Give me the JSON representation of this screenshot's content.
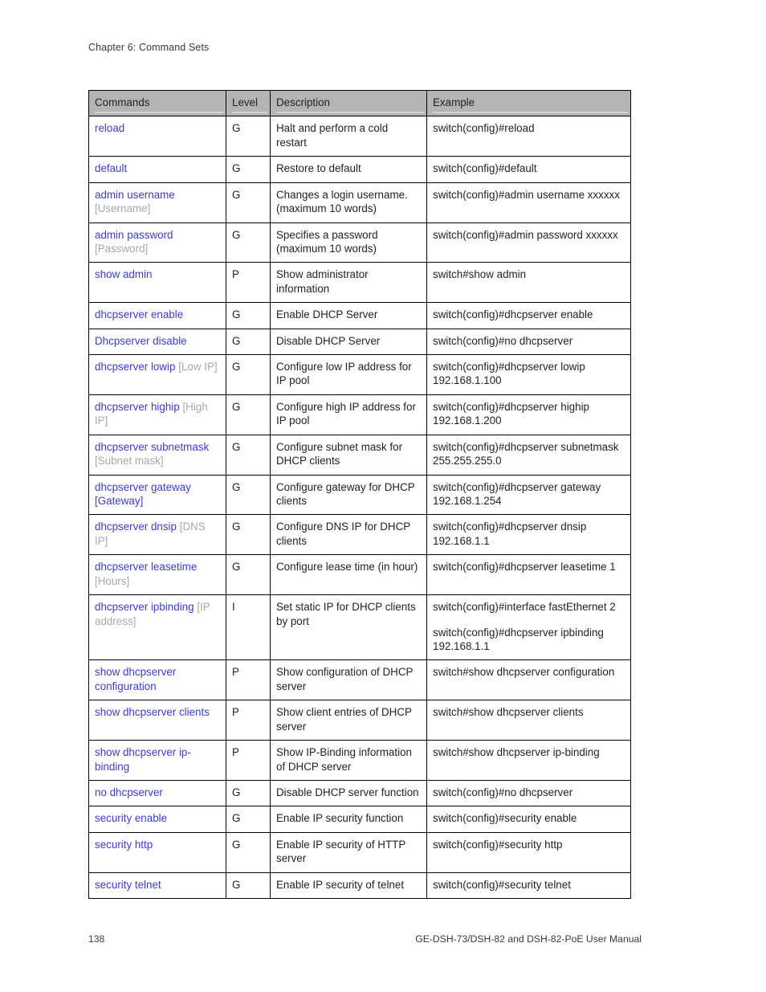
{
  "header": {
    "chapter": "Chapter 6: Command Sets"
  },
  "table": {
    "columns": [
      "Commands",
      "Level",
      "Description",
      "Example"
    ],
    "rows": [
      {
        "command": "reload",
        "param": "",
        "param_style": "gray",
        "level": "G",
        "description": "Halt and perform a cold restart",
        "examples": [
          "switch(config)#reload"
        ]
      },
      {
        "command": "default",
        "param": "",
        "param_style": "gray",
        "level": "G",
        "description": "Restore to default",
        "examples": [
          "switch(config)#default"
        ]
      },
      {
        "command": "admin username",
        "param": "[Username]",
        "param_style": "gray-newline",
        "level": "G",
        "description": "Changes a login username. (maximum 10 words)",
        "examples": [
          "switch(config)#admin username xxxxxx"
        ]
      },
      {
        "command": "admin password",
        "param": "[Password]",
        "param_style": "gray-newline",
        "level": "G",
        "description": "Specifies a password (maximum 10 words)",
        "examples": [
          "switch(config)#admin password xxxxxx"
        ]
      },
      {
        "command": "show admin",
        "param": "",
        "param_style": "gray",
        "level": "P",
        "description": "Show administrator information",
        "examples": [
          "switch#show admin"
        ]
      },
      {
        "command": "dhcpserver enable",
        "param": "",
        "param_style": "gray",
        "level": "G",
        "description": "Enable DHCP Server",
        "examples": [
          "switch(config)#dhcpserver enable"
        ]
      },
      {
        "command": "Dhcpserver disable",
        "param": "",
        "param_style": "gray",
        "level": "G",
        "description": "Disable DHCP Server",
        "examples": [
          "switch(config)#no dhcpserver"
        ]
      },
      {
        "command": "dhcpserver lowip",
        "param": "[Low IP]",
        "param_style": "gray",
        "level": "G",
        "description": "Configure low IP address for IP pool",
        "examples": [
          "switch(config)#dhcpserver lowip 192.168.1.100"
        ]
      },
      {
        "command": "dhcpserver highip",
        "param": "[High IP]",
        "param_style": "gray",
        "level": "G",
        "description": "Configure high IP address for IP pool",
        "examples": [
          "switch(config)#dhcpserver highip 192.168.1.200"
        ]
      },
      {
        "command": "dhcpserver subnetmask",
        "param": "[Subnet mask]",
        "param_style": "gray-newline",
        "level": "G",
        "description": "Configure subnet mask for DHCP clients",
        "examples": [
          "switch(config)#dhcpserver subnetmask 255.255.255.0"
        ]
      },
      {
        "command": "dhcpserver gateway",
        "param": "[Gateway]",
        "param_style": "blue-newline",
        "level": "G",
        "description": "Configure gateway for DHCP clients",
        "examples": [
          "switch(config)#dhcpserver gateway 192.168.1.254"
        ]
      },
      {
        "command": "dhcpserver dnsip",
        "param": "[DNS IP]",
        "param_style": "gray",
        "level": "G",
        "description": "Configure DNS IP for DHCP clients",
        "examples": [
          "switch(config)#dhcpserver dnsip 192.168.1.1"
        ]
      },
      {
        "command": "dhcpserver leasetime",
        "param": "[Hours]",
        "param_style": "gray-newline",
        "level": "G",
        "description": "Configure lease time (in hour)",
        "examples": [
          "switch(config)#dhcpserver leasetime 1"
        ]
      },
      {
        "command": "dhcpserver ipbinding",
        "param": "[IP address]",
        "param_style": "gray",
        "level": "I",
        "description": "Set static IP for DHCP clients by port",
        "examples": [
          "switch(config)#interface fastEthernet 2",
          "switch(config)#dhcpserver ipbinding 192.168.1.1"
        ]
      },
      {
        "command": "show dhcpserver configuration",
        "param": "",
        "param_style": "gray",
        "level": "P",
        "description": "Show configuration of DHCP server",
        "examples": [
          "switch#show dhcpserver configuration"
        ]
      },
      {
        "command": "show dhcpserver clients",
        "param": "",
        "param_style": "gray",
        "level": "P",
        "description": "Show client entries of DHCP server",
        "examples": [
          "switch#show dhcpserver clients"
        ]
      },
      {
        "command": "show dhcpserver ip-binding",
        "param": "",
        "param_style": "gray",
        "level": "P",
        "description": "Show IP-Binding information of DHCP server",
        "examples": [
          "switch#show dhcpserver ip-binding"
        ]
      },
      {
        "command": "no dhcpserver",
        "param": "",
        "param_style": "gray",
        "level": "G",
        "description": "Disable DHCP server function",
        "examples": [
          "switch(config)#no dhcpserver"
        ]
      },
      {
        "command": "security enable",
        "param": "",
        "param_style": "gray",
        "level": "G",
        "description": "Enable IP security function",
        "examples": [
          "switch(config)#security enable"
        ]
      },
      {
        "command": "security http",
        "param": "",
        "param_style": "gray",
        "level": "G",
        "description": "Enable IP security of HTTP server",
        "examples": [
          "switch(config)#security http"
        ]
      },
      {
        "command": "security telnet",
        "param": "",
        "param_style": "gray",
        "level": "G",
        "description": "Enable IP security of telnet",
        "examples": [
          "switch(config)#security telnet"
        ]
      }
    ]
  },
  "footer": {
    "page_number": "138",
    "manual_title": "GE-DSH-73/DSH-82 and DSH-82-PoE User Manual"
  },
  "colors": {
    "command_link": "#3b3bdb",
    "parameter_gray": "#a8a8a8",
    "header_background": "#b4b4b4",
    "body_text": "#231f20",
    "border": "#000000"
  }
}
